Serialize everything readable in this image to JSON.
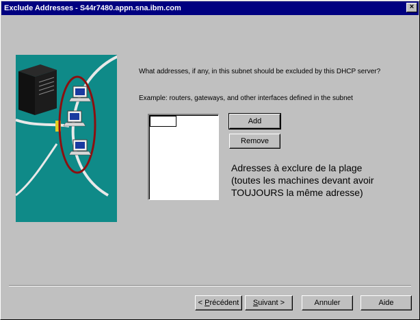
{
  "window": {
    "title": "Exclude Addresses - S44r7480.appn.sna.ibm.com",
    "close_glyph": "×"
  },
  "content": {
    "prompt": "What addresses, if any, in this subnet should be excluded by this DHCP server?",
    "example": "Example:  routers, gateways, and other interfaces defined in the subnet"
  },
  "list": {
    "items": []
  },
  "buttons": {
    "add": "Add",
    "remove": "Remove"
  },
  "annotation": {
    "lines": [
      "Adresses à exclure de la plage",
      "(toutes les machines devant avoir",
      " TOUJOURS la même adresse)"
    ]
  },
  "footer": {
    "back": {
      "prefix": "< ",
      "mnemonic": "P",
      "rest": "récédent"
    },
    "next": {
      "mnemonic": "S",
      "rest": "uivant >"
    },
    "cancel": "Annuler",
    "help": "Aide"
  },
  "colors": {
    "titlebar": "#000080",
    "illustration_bg": "#0f8a88",
    "ring": "#8b1010"
  }
}
